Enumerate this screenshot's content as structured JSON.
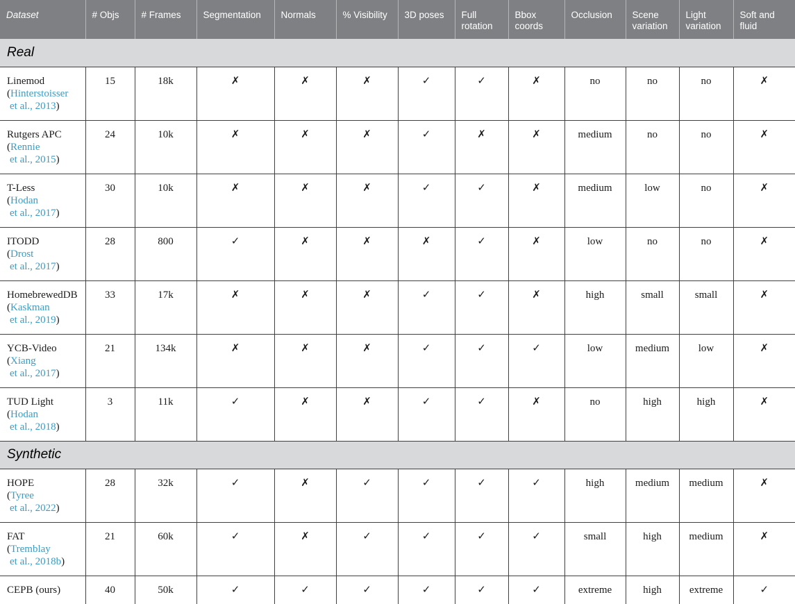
{
  "headers": [
    "Dataset",
    "# Objs",
    "# Frames",
    "Segmentation",
    "Normals",
    "% Visibility",
    "3D poses",
    "Full rotation",
    "Bbox coords",
    "Occlusion",
    "Scene variation",
    "Light variation",
    "Soft and fluid"
  ],
  "sections": [
    {
      "title": "Real",
      "rows": [
        {
          "name": "Linemod",
          "ref_a": "Hinterstoisser",
          "ref_b": "et al., 2013",
          "values": [
            "15",
            "18k",
            "✗",
            "✗",
            "✗",
            "✓",
            "✓",
            "✗",
            "no",
            "no",
            "no",
            "✗"
          ]
        },
        {
          "name": "Rutgers APC",
          "ref_a": "Rennie",
          "ref_b": "et al., 2015",
          "values": [
            "24",
            "10k",
            "✗",
            "✗",
            "✗",
            "✓",
            "✗",
            "✗",
            "medium",
            "no",
            "no",
            "✗"
          ]
        },
        {
          "name": "T-Less",
          "ref_a": "Hodan",
          "ref_b": "et al., 2017",
          "values": [
            "30",
            "10k",
            "✗",
            "✗",
            "✗",
            "✓",
            "✓",
            "✗",
            "medium",
            "low",
            "no",
            "✗"
          ]
        },
        {
          "name": "ITODD",
          "ref_a": "Drost",
          "ref_b": "et al., 2017",
          "values": [
            "28",
            "800",
            "✓",
            "✗",
            "✗",
            "✗",
            "✓",
            "✗",
            "low",
            "no",
            "no",
            "✗"
          ]
        },
        {
          "name": "HomebrewedDB",
          "ref_a": "Kaskman",
          "ref_b": "et al., 2019",
          "values": [
            "33",
            "17k",
            "✗",
            "✗",
            "✗",
            "✓",
            "✓",
            "✗",
            "high",
            "small",
            "small",
            "✗"
          ]
        },
        {
          "name": "YCB-Video",
          "ref_a": "Xiang",
          "ref_b": "et al., 2017",
          "values": [
            "21",
            "134k",
            "✗",
            "✗",
            "✗",
            "✓",
            "✓",
            "✓",
            "low",
            "medium",
            "low",
            "✗"
          ]
        },
        {
          "name": "TUD Light",
          "ref_a": "Hodan",
          "ref_b": "et al., 2018",
          "values": [
            "3",
            "11k",
            "✓",
            "✗",
            "✗",
            "✓",
            "✓",
            "✗",
            "no",
            "high",
            "high",
            "✗"
          ]
        }
      ]
    },
    {
      "title": "Synthetic",
      "rows": [
        {
          "name": "HOPE",
          "ref_a": "Tyree",
          "ref_b": "et al., 2022",
          "values": [
            "28",
            "32k",
            "✓",
            "✗",
            "✓",
            "✓",
            "✓",
            "✓",
            "high",
            "medium",
            "medium",
            "✗"
          ]
        },
        {
          "name": "FAT",
          "ref_a": "Tremblay",
          "ref_b": "et al., 2018b",
          "values": [
            "21",
            "60k",
            "✓",
            "✗",
            "✓",
            "✓",
            "✓",
            "✓",
            "small",
            "high",
            "medium",
            "✗"
          ]
        },
        {
          "name": "CEPB (ours)",
          "ref_a": "",
          "ref_b": "",
          "values": [
            "40",
            "50k",
            "✓",
            "✓",
            "✓",
            "✓",
            "✓",
            "✓",
            "extreme",
            "high",
            "extreme",
            "✓"
          ]
        }
      ]
    }
  ]
}
